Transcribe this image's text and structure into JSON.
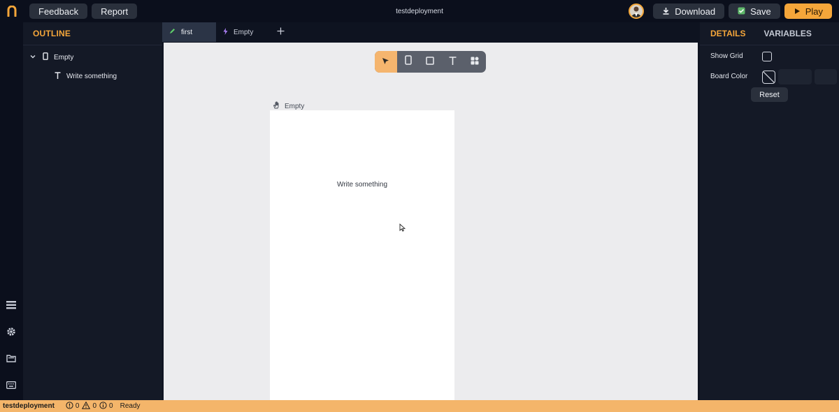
{
  "topbar": {
    "feedback_label": "Feedback",
    "report_label": "Report",
    "project_title": "testdeployment",
    "download_label": "Download",
    "save_label": "Save",
    "play_label": "Play"
  },
  "outline": {
    "title": "OUTLINE",
    "items": [
      {
        "label": "Empty",
        "icon": "phone-icon"
      },
      {
        "label": "Write something",
        "icon": "text-icon"
      }
    ]
  },
  "tabs": [
    {
      "label": "first",
      "icon": "pencil-icon",
      "active": true
    },
    {
      "label": "Empty",
      "icon": "lightning-icon",
      "active": false
    }
  ],
  "canvas": {
    "board_label": "Empty",
    "board_text": "Write something",
    "tools": [
      "pointer-tool",
      "phone-tool",
      "rectangle-tool",
      "text-tool",
      "components-tool"
    ]
  },
  "rightpanel": {
    "details_tab": "DETAILS",
    "variables_tab": "VARIABLES",
    "show_grid_label": "Show Grid",
    "board_color_label": "Board Color",
    "reset_label": "Reset"
  },
  "statusbar": {
    "project": "testdeployment",
    "errors": "0",
    "warnings": "0",
    "infos": "0",
    "status": "Ready"
  },
  "colors": {
    "accent": "#f5a63a",
    "statusbar": "#f4b56a",
    "panel": "#141926",
    "canvas": "#ececee"
  }
}
